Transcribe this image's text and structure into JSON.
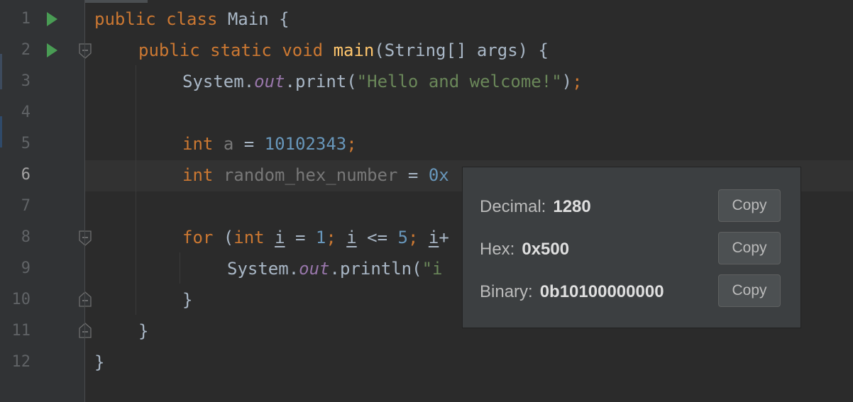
{
  "gutter": {
    "line_numbers": [
      "1",
      "2",
      "3",
      "4",
      "5",
      "6",
      "7",
      "8",
      "9",
      "10",
      "11",
      "12"
    ],
    "current_line": "6"
  },
  "code": {
    "line1": {
      "kw1": "public",
      "kw2": "class",
      "name": "Main {"
    },
    "line2": {
      "kw1": "public",
      "kw2": "static",
      "kw3": "void",
      "method": "main",
      "rest": "(String[] args) {"
    },
    "line3": {
      "obj": "System.",
      "field": "out",
      "call": ".print(",
      "str": "\"Hello and welcome!\"",
      "end": ")",
      "semi": ";"
    },
    "line5": {
      "kw": "int",
      "var": "a",
      "op": " = ",
      "num": "10102343",
      "semi": ";"
    },
    "line6": {
      "kw": "int",
      "var": "random_hex_number",
      "op": " = ",
      "num_start": "0x"
    },
    "line8": {
      "kw_for": "for",
      "open": " (",
      "kw_int": "int",
      "sp": " ",
      "var_i": "i",
      "eq": " = ",
      "num1": "1",
      "semi1": ";",
      "sp2": " ",
      "var_i2": "i",
      "lte": " <= ",
      "num5": "5",
      "semi2": ";",
      "sp3": " ",
      "var_i3": "i",
      "cut": "+"
    },
    "line9": {
      "obj": "System.",
      "field": "out",
      "call": ".println(",
      "str_start": "\"i"
    },
    "line10": {
      "text": "}"
    },
    "line11": {
      "text": "}"
    },
    "line12": {
      "text": "}"
    }
  },
  "popup": {
    "decimal": {
      "label": "Decimal:",
      "value": "1280",
      "copy": "Copy"
    },
    "hex": {
      "label": "Hex:",
      "value": "0x500",
      "copy": "Copy"
    },
    "binary": {
      "label": "Binary:",
      "value": "0b10100000000",
      "copy": "Copy"
    }
  },
  "colors": {
    "background": "#2b2b2b",
    "keyword": "#cc7832",
    "method": "#ffc66d",
    "string": "#6a8759",
    "number": "#6897bb",
    "field": "#9876aa",
    "run_icon": "#499c54"
  }
}
